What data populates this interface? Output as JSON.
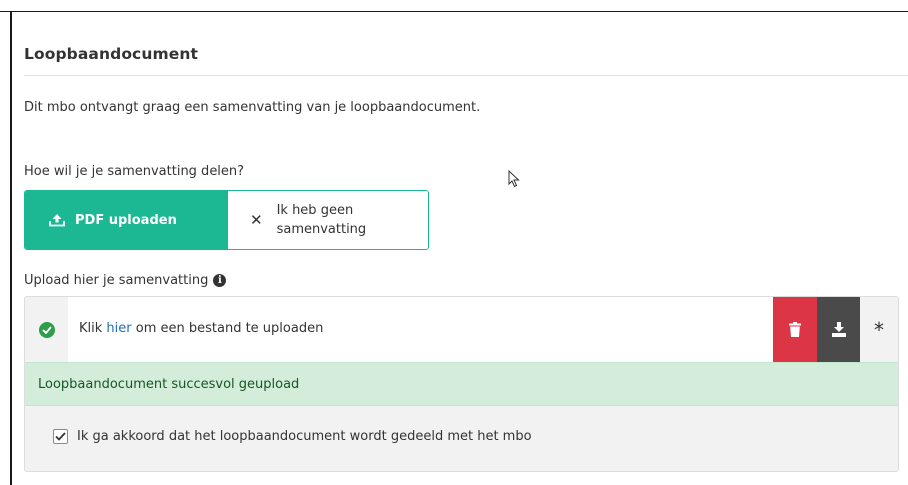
{
  "section": {
    "title": "Loopbaandocument",
    "intro": "Dit mbo ontvangt graag een samenvatting van je loopbaandocument."
  },
  "share": {
    "question": "Hoe wil je je samenvatting delen?",
    "options": [
      {
        "label": "PDF uploaden",
        "icon": "upload-icon",
        "selected": true
      },
      {
        "label": "Ik heb geen samenvatting",
        "icon": "close-icon",
        "selected": false
      }
    ]
  },
  "upload": {
    "label": "Upload hier je samenvatting",
    "info_icon": "info-icon",
    "file_prefix": "Klik ",
    "file_link": "hier",
    "file_suffix": " om een bestand te uploaden",
    "status_icon": "check-circle-icon",
    "delete_icon": "trash-icon",
    "download_icon": "download-icon",
    "required_marker": "*",
    "success_message": "Loopbaandocument succesvol geupload",
    "agreement_label": "Ik ga akkoord dat het loopbaandocument wordt gedeeld met het mbo",
    "agreement_checked": true
  },
  "colors": {
    "accent": "#1bb893",
    "danger": "#dc3545",
    "dark": "#4a4a4a",
    "success_bg": "#d4edda",
    "success_text": "#155724",
    "link": "#1f6fb5"
  }
}
